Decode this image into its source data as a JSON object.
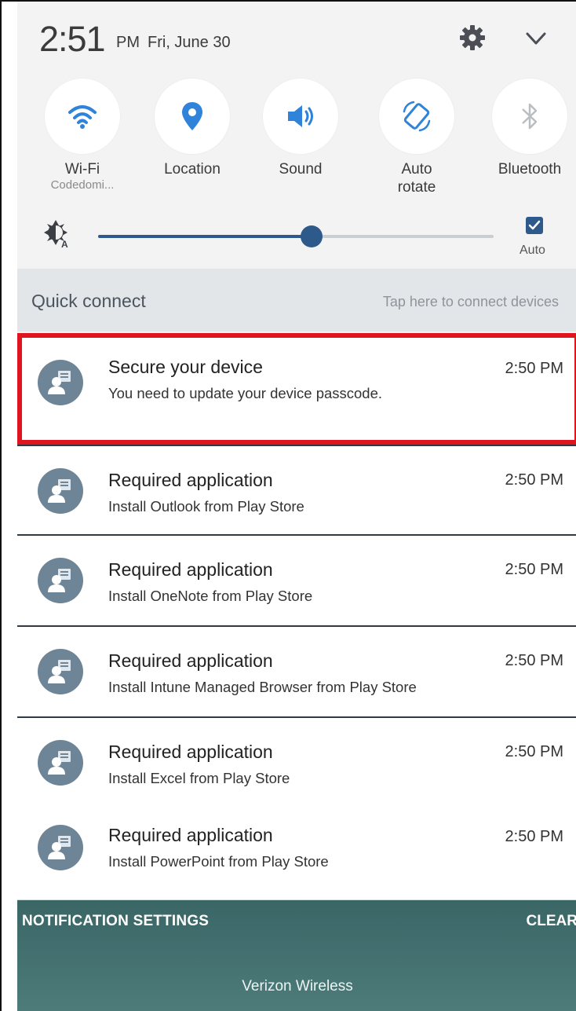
{
  "status": {
    "time": "2:51",
    "ampm": "PM",
    "date": "Fri, June 30"
  },
  "toggles": [
    {
      "label": "Wi-Fi",
      "sublabel": "Codedomi...",
      "icon": "wifi-icon"
    },
    {
      "label": "Location",
      "sublabel": "",
      "icon": "location-pin-icon"
    },
    {
      "label": "Sound",
      "sublabel": "",
      "icon": "speaker-icon"
    },
    {
      "label": "Auto rotate",
      "label_line1": "Auto",
      "label_line2": "rotate",
      "icon": "auto-rotate-icon"
    },
    {
      "label": "Bluetooth",
      "sublabel": "",
      "icon": "bluetooth-icon"
    }
  ],
  "brightness": {
    "level": 0.54,
    "auto_label": "Auto",
    "auto_checked": true
  },
  "quick_connect": {
    "title": "Quick connect",
    "hint": "Tap here to connect devices"
  },
  "notifications": [
    {
      "title": "Secure your device",
      "time": "2:50 PM",
      "text": "You need to update your device passcode.",
      "highlighted": true
    },
    {
      "title": "Required application",
      "time": "2:50 PM",
      "text": "Install Outlook from Play Store"
    },
    {
      "title": "Required application",
      "time": "2:50 PM",
      "text": "Install OneNote from Play Store"
    },
    {
      "title": "Required application",
      "time": "2:50 PM",
      "text": "Install Intune Managed Browser from Play Store"
    },
    {
      "title": "Required application",
      "time": "2:50 PM",
      "text": "Install Excel from Play Store"
    },
    {
      "title": "Required application",
      "time": "2:50 PM",
      "text": "Install PowerPoint from Play Store"
    }
  ],
  "bottom": {
    "settings_label": "NOTIFICATION SETTINGS",
    "clear_label": "CLEAR",
    "carrier": "Verizon Wireless"
  },
  "colors": {
    "accent": "#2d5a8a",
    "highlight": "#e0141e",
    "avatar": "#6d8597",
    "bottom_bar": "#3f6e6e"
  }
}
